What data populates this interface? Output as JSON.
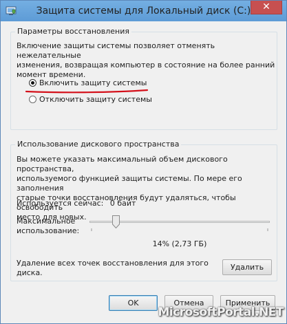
{
  "window": {
    "title": "Защита системы для Локальный диск (C:)",
    "close_symbol": "✕"
  },
  "restore_group": {
    "title": "Параметры восстановления",
    "description": [
      "Включение защиты системы позволяет отменять нежелательные",
      "изменения, возвращая компьютер в состояние на более ранний",
      "момент времени."
    ],
    "options": [
      {
        "label": "Включить защиту системы",
        "selected": true
      },
      {
        "label": "Отключить защиту системы",
        "selected": false
      }
    ]
  },
  "disk_group": {
    "title": "Использование дискового пространства",
    "description": [
      "Вы можете указать максимальный объем дискового пространства,",
      "используемого функцией защиты системы. По мере его заполнения",
      "старые точки восстановления будут удаляться, чтобы освободить",
      "место для новых."
    ],
    "current_usage_label": "Используется сейчас:",
    "current_usage_value": "0 байт",
    "max_usage_label_line1": "Максимальное",
    "max_usage_label_line2": "использование:",
    "slider_value_fraction": 0.14,
    "slider_value_text": "14% (2,73 ГБ)",
    "delete_text_line1": "Удаление всех точек восстановления для этого",
    "delete_text_line2": "диска.",
    "delete_button": "Удалить"
  },
  "footer": {
    "ok_button": "OK",
    "cancel_button": "Отмена",
    "apply_button": "Применить"
  },
  "watermark": "MicrosoftPortal.NET",
  "colors": {
    "titlebar": "#68a5dd",
    "annotation_underline": "#d4101a",
    "close_button": "#c75050"
  }
}
